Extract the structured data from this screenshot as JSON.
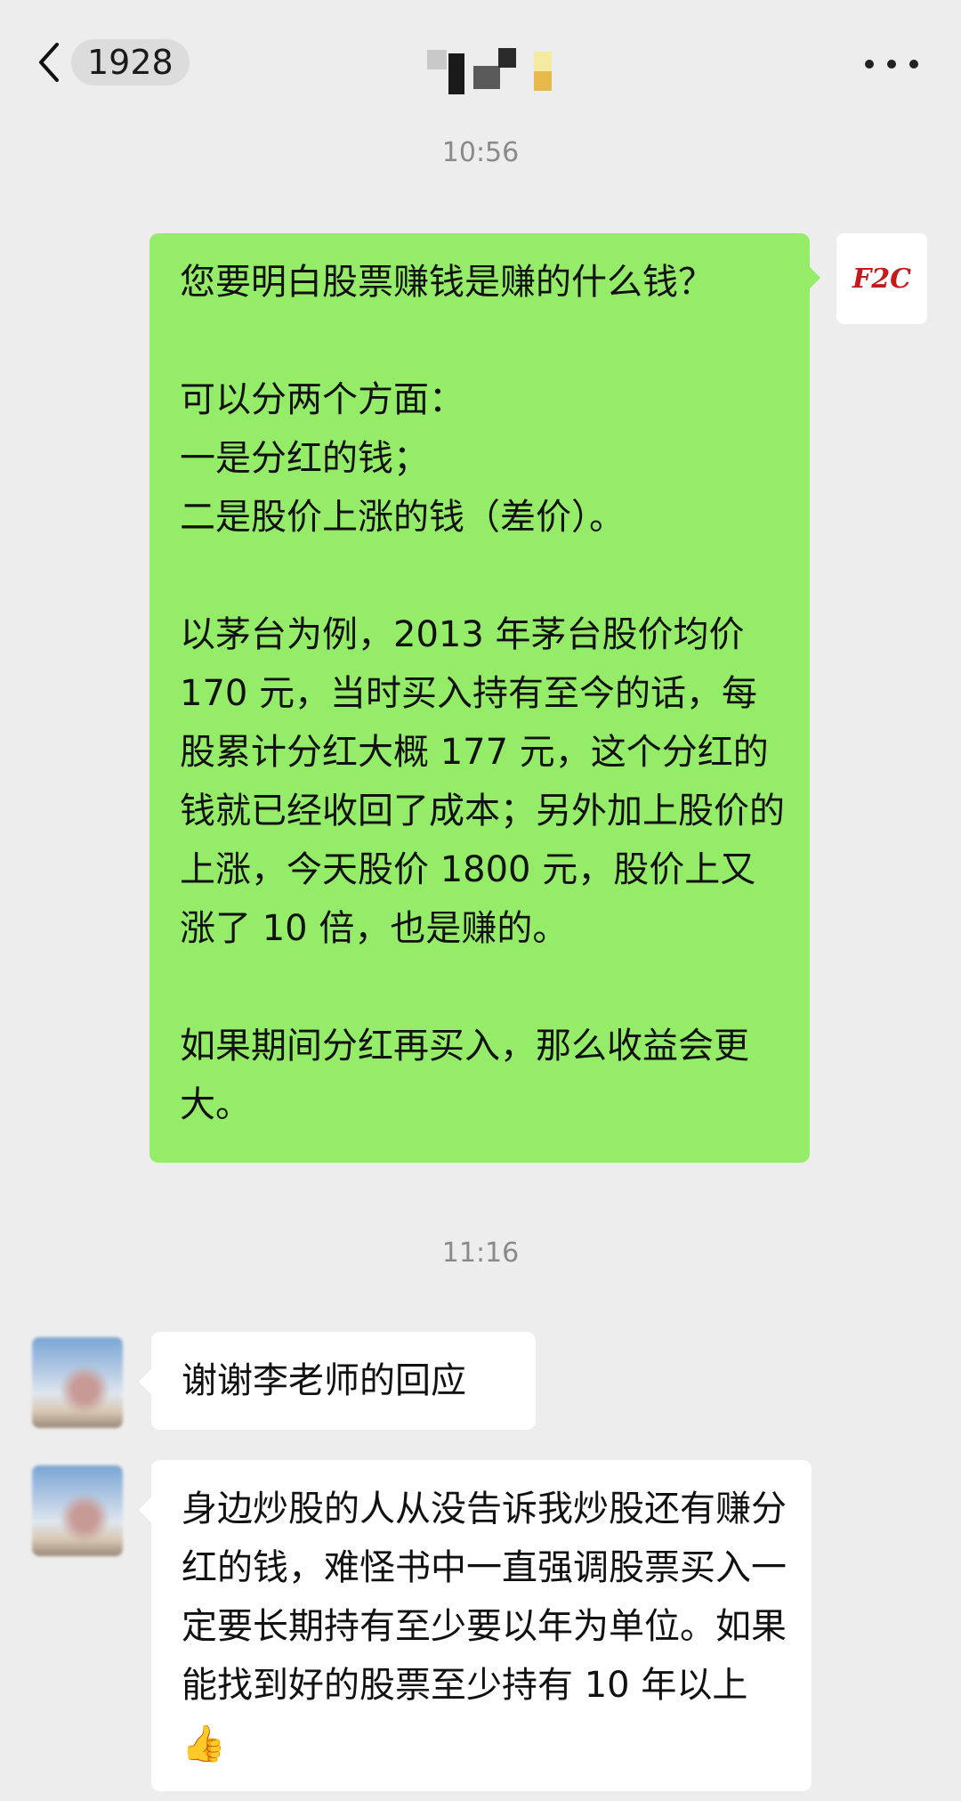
{
  "header": {
    "back_badge": "1928",
    "more_icon": "more-dots-icon",
    "back_icon": "chevron-left-icon"
  },
  "messages": {
    "time_1": "10:56",
    "msg_1": "您要明白股票赚钱是赚的什么钱？\n\n可以分两个方面：\n一是分红的钱；\n二是股价上涨的钱（差价）。\n\n以茅台为例，2013 年茅台股价均价 170 元，当时买入持有至今的话，每股累计分红大概 177 元，这个分红的钱就已经收回了成本；另外加上股价的上涨，今天股价 1800 元，股价上又涨了 10 倍，也是赚的。\n\n如果期间分红再买入，那么收益会更大。",
    "sender_avatar_text": "F2C",
    "time_2": "11:16",
    "msg_2": "谢谢李老师的回应",
    "msg_3": "身边炒股的人从没告诉我炒股还有赚分红的钱，难怪书中一直强调股票买入一定要长期持有至少要以年为单位。如果能找到好的股票至少持有 10 年以上",
    "msg_3_emoji": "👍"
  },
  "colors": {
    "background": "#ededed",
    "sent_bubble": "#95ec69",
    "received_bubble": "#ffffff",
    "timestamp": "#8a8a8a"
  }
}
